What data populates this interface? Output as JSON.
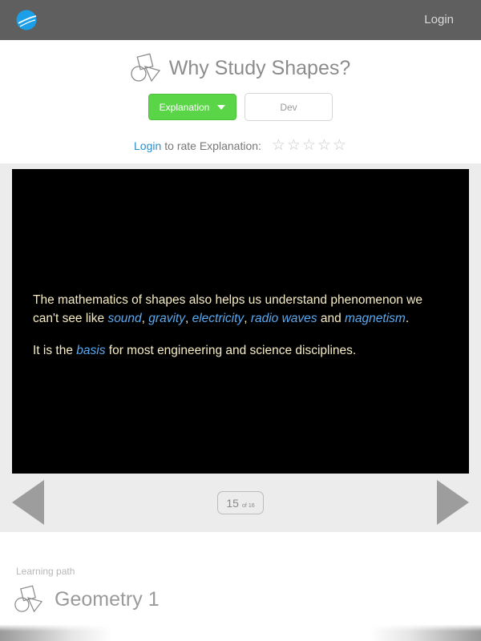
{
  "topbar": {
    "login_label": "Login"
  },
  "header": {
    "title": "Why Study Shapes?",
    "explanation_label": "Explanation",
    "dev_label": "Dev"
  },
  "rating": {
    "login_link": "Login",
    "text": "to rate Explanation:",
    "stars": [
      "☆",
      "☆",
      "☆",
      "☆",
      "☆"
    ],
    "value": 0,
    "max": 5
  },
  "slide": {
    "p1_before": "The mathematics of shapes also helps us understand phenomenon we can't see like ",
    "kw_sound": "sound",
    "sep1": ", ",
    "kw_gravity": "gravity",
    "sep2": ", ",
    "kw_electricity": "electricity",
    "sep3": ", ",
    "kw_radio": "radio waves",
    "and": " and ",
    "kw_magnetism": "magnetism",
    "end": ".",
    "p2_before": "It is the ",
    "kw_basis": "basis",
    "p2_after": " for most engineering and science disciplines.",
    "text_color": "#f6ecc4",
    "keyword_color": "#5aa9ef"
  },
  "pager": {
    "current": "15",
    "of_label": "of",
    "total": "16"
  },
  "learning_path": {
    "label": "Learning path",
    "title": "Geometry 1"
  },
  "colors": {
    "topbar": "#5f5f5f",
    "accent_green": "#5bd548",
    "link_blue": "#2a8fd0",
    "logo_blue": "#1a9fe8"
  },
  "icons": {
    "logo": "globe-logo-icon",
    "shapes": "shapes-icon",
    "prev": "prev-arrow-icon",
    "next": "next-arrow-icon",
    "caret": "caret-down-icon"
  }
}
